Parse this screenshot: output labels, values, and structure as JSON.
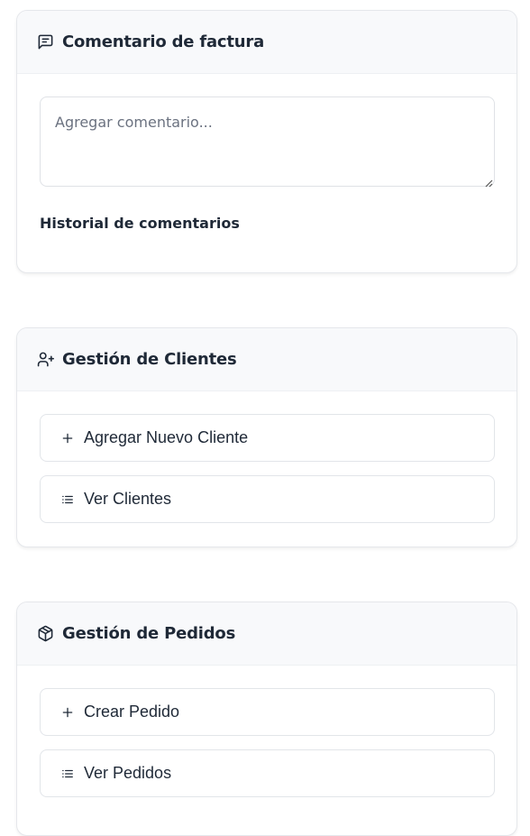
{
  "invoice_comment": {
    "title": "Comentario de factura",
    "icon": "message-square-text-icon",
    "comment_placeholder": "Agregar comentario...",
    "comment_value": "",
    "history_label": "Historial de comentarios"
  },
  "clients": {
    "title": "Gestión de Clientes",
    "icon": "user-plus-icon",
    "actions": [
      {
        "label": "Agregar Nuevo Cliente",
        "icon": "plus-icon"
      },
      {
        "label": "Ver Clientes",
        "icon": "list-icon"
      }
    ]
  },
  "orders": {
    "title": "Gestión de Pedidos",
    "icon": "package-icon",
    "actions": [
      {
        "label": "Crear Pedido",
        "icon": "plus-icon"
      },
      {
        "label": "Ver Pedidos",
        "icon": "list-icon"
      }
    ]
  }
}
